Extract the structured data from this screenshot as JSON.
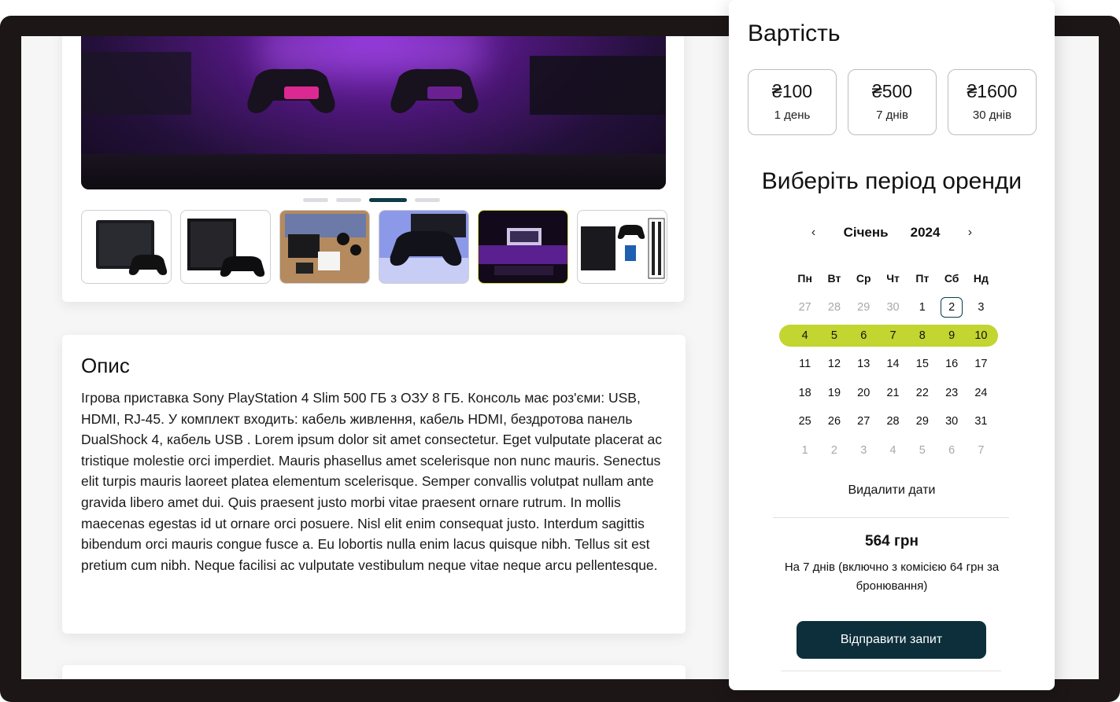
{
  "gallery": {
    "thumbnails": [
      {
        "alt": "ps4-slim-with-controller"
      },
      {
        "alt": "ps4-console-with-controller"
      },
      {
        "alt": "ps4-unboxing-flatlay"
      },
      {
        "alt": "controller-on-console"
      },
      {
        "alt": "gaming-room-purple"
      },
      {
        "alt": "ps4-bundle-box"
      }
    ],
    "active_dot": 2,
    "dot_count": 4
  },
  "description": {
    "title": "Опис",
    "text": "Ігрова приставка Sony PlayStation 4 Slim 500 ГБ з ОЗУ 8 ГБ. Консоль має роз'єми: USB, HDMI, RJ-45. У комплект входить: кабель живлення, кабель HDMI, бездротова панель DualShock 4, кабель USB . Lorem ipsum dolor sit amet consectetur. Eget vulputate placerat ac tristique molestie orci imperdiet. Mauris phasellus amet scelerisque non nunc mauris. Senectus elit turpis mauris laoreet platea elementum scelerisque. Semper convallis volutpat nullam ante gravida libero amet dui. Quis praesent justo morbi vitae praesent ornare rutrum. In mollis maecenas egestas id ut ornare orci posuere. Nisl elit enim consequat justo. Interdum sagittis bibendum orci mauris congue fusce a. Eu lobortis nulla enim lacus quisque nibh. Tellus sit est pretium cum nibh. Neque facilisi ac vulputate vestibulum neque vitae neque arcu pellentesque."
  },
  "pricing": {
    "title": "Вартість",
    "options": [
      {
        "amount": "₴100",
        "period": "1 день"
      },
      {
        "amount": "₴500",
        "period": "7 днів"
      },
      {
        "amount": "₴1600",
        "period": "30 днів"
      }
    ]
  },
  "calendar": {
    "title": "Виберіть період оренди",
    "month": "Січень",
    "year": "2024",
    "prev_icon": "‹",
    "next_icon": "›",
    "weekdays": [
      "Пн",
      "Вт",
      "Ср",
      "Чт",
      "Пт",
      "Сб",
      "Нд"
    ],
    "weeks": [
      [
        "27",
        "28",
        "29",
        "30",
        "1",
        "2",
        "3"
      ],
      [
        "4",
        "5",
        "6",
        "7",
        "8",
        "9",
        "10"
      ],
      [
        "11",
        "12",
        "13",
        "14",
        "15",
        "16",
        "17"
      ],
      [
        "18",
        "19",
        "20",
        "21",
        "22",
        "23",
        "24"
      ],
      [
        "25",
        "26",
        "27",
        "28",
        "29",
        "30",
        "31"
      ],
      [
        "1",
        "2",
        "3",
        "4",
        "5",
        "6",
        "7"
      ]
    ],
    "today": "2",
    "range_color": "#c2d530",
    "clear_label": "Видалити дати"
  },
  "summary": {
    "total": "564 грн",
    "note": "На 7 днів (включно з комісією 64 грн за бронювання)",
    "submit_label": "Відправити запит"
  },
  "colors": {
    "accent": "#0c2f3b",
    "range": "#c2d530",
    "frame": "#1c1616"
  }
}
